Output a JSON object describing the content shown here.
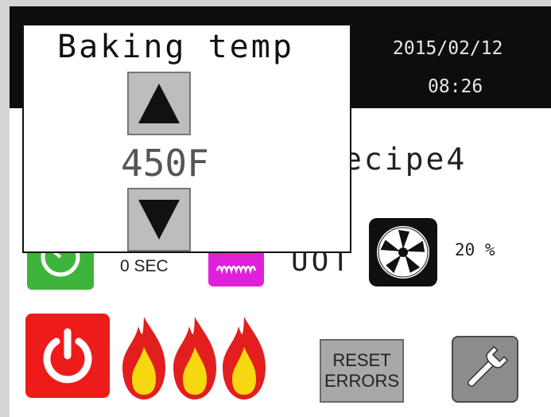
{
  "header": {
    "date": "2015/02/12",
    "time": "08:26"
  },
  "recipe_name": "ecipe4",
  "timer": {
    "value": "0 SEC"
  },
  "fan": {
    "percent": "20 %"
  },
  "mode_text": "UOT",
  "reset_button": {
    "line1": "RESET",
    "line2": "ERRORS"
  },
  "dialog": {
    "title": "Baking temp",
    "value": "450F"
  },
  "icons": {
    "temperature": "thermometer-icon",
    "timer": "timer-icon",
    "heater": "heater-icon",
    "fan": "fan-icon",
    "power": "power-icon",
    "flame": "flame-icon",
    "settings": "wrench-icon",
    "up": "up-arrow-icon",
    "down": "down-arrow-icon"
  },
  "colors": {
    "temperature_tile": "#f07a1e",
    "timer_tile": "#3db53a",
    "heater_tile": "#e020d8",
    "power_tile": "#ee1b1b",
    "flame_outer": "#e31e1e",
    "flame_inner": "#f5d80f",
    "header_bg": "#0d0d0d"
  },
  "burners_lit": 3
}
